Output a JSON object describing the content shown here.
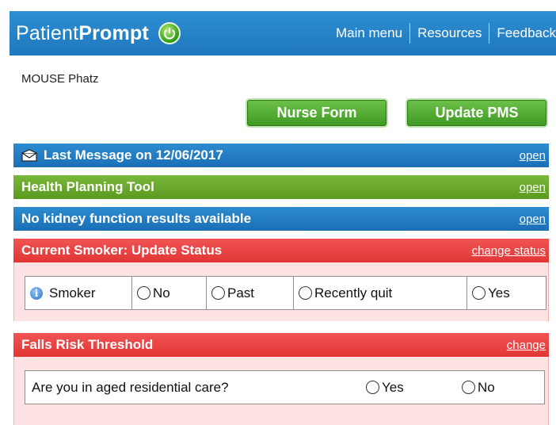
{
  "header": {
    "logo_light": "Patient",
    "logo_bold": "Prompt",
    "nav": [
      "Main menu",
      "Resources",
      "Feedback"
    ]
  },
  "patient_name": "MOUSE Phatz",
  "buttons": {
    "nurse_form": "Nurse Form",
    "update_pms": "Update PMS"
  },
  "bars": {
    "last_message": {
      "title": "Last Message on 12/06/2017",
      "action": "open"
    },
    "health_planning": {
      "title": "Health Planning Tool",
      "action": "open"
    },
    "kidney": {
      "title": "No kidney function results available",
      "action": "open"
    },
    "smoker": {
      "title": "Current Smoker: Update Status",
      "action": "change status"
    },
    "falls": {
      "title": "Falls Risk Threshold",
      "action": "change"
    }
  },
  "smoker_options": {
    "label": "Smoker",
    "no": "No",
    "past": "Past",
    "recently_quit": "Recently quit",
    "yes": "Yes"
  },
  "falls": {
    "question": "Are you in aged residential care?",
    "yes": "Yes",
    "no": "No"
  },
  "colors": {
    "blue_bar": "#1f77bd",
    "green_bar": "#5b9a1f",
    "red_bar": "#e23535",
    "panel_bg": "#fde3e3"
  }
}
